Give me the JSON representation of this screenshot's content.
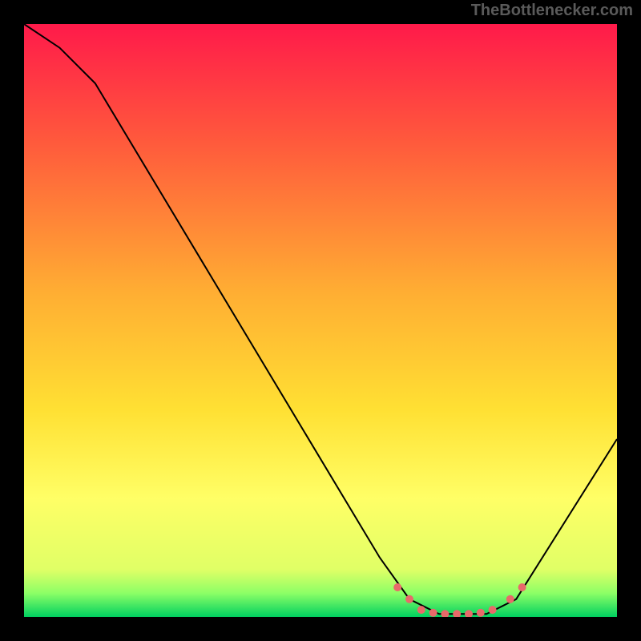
{
  "watermark": "TheBottlenecker.com",
  "chart_data": {
    "type": "line",
    "title": "",
    "xlabel": "",
    "ylabel": "",
    "xlim": [
      0,
      100
    ],
    "ylim": [
      0,
      100
    ],
    "grid": false,
    "gradient_stops": [
      {
        "offset": 0,
        "color": "#ff1a4a"
      },
      {
        "offset": 20,
        "color": "#ff5a3c"
      },
      {
        "offset": 45,
        "color": "#ffad33"
      },
      {
        "offset": 65,
        "color": "#ffe033"
      },
      {
        "offset": 80,
        "color": "#ffff66"
      },
      {
        "offset": 92,
        "color": "#e0ff66"
      },
      {
        "offset": 96,
        "color": "#8cff66"
      },
      {
        "offset": 100,
        "color": "#00d060"
      }
    ],
    "series": [
      {
        "name": "curve",
        "color": "#000000",
        "width": 2,
        "points": [
          {
            "x": 0,
            "y": 100
          },
          {
            "x": 6,
            "y": 96
          },
          {
            "x": 12,
            "y": 90
          },
          {
            "x": 60,
            "y": 10
          },
          {
            "x": 65,
            "y": 3
          },
          {
            "x": 70,
            "y": 0.5
          },
          {
            "x": 78,
            "y": 0.5
          },
          {
            "x": 83,
            "y": 3
          },
          {
            "x": 100,
            "y": 30
          }
        ]
      }
    ],
    "markers": {
      "color": "#e86a6a",
      "radius": 5,
      "points": [
        {
          "x": 63,
          "y": 5
        },
        {
          "x": 65,
          "y": 3
        },
        {
          "x": 67,
          "y": 1.2
        },
        {
          "x": 69,
          "y": 0.7
        },
        {
          "x": 71,
          "y": 0.5
        },
        {
          "x": 73,
          "y": 0.5
        },
        {
          "x": 75,
          "y": 0.5
        },
        {
          "x": 77,
          "y": 0.7
        },
        {
          "x": 79,
          "y": 1.2
        },
        {
          "x": 82,
          "y": 3
        },
        {
          "x": 84,
          "y": 5
        }
      ]
    }
  }
}
